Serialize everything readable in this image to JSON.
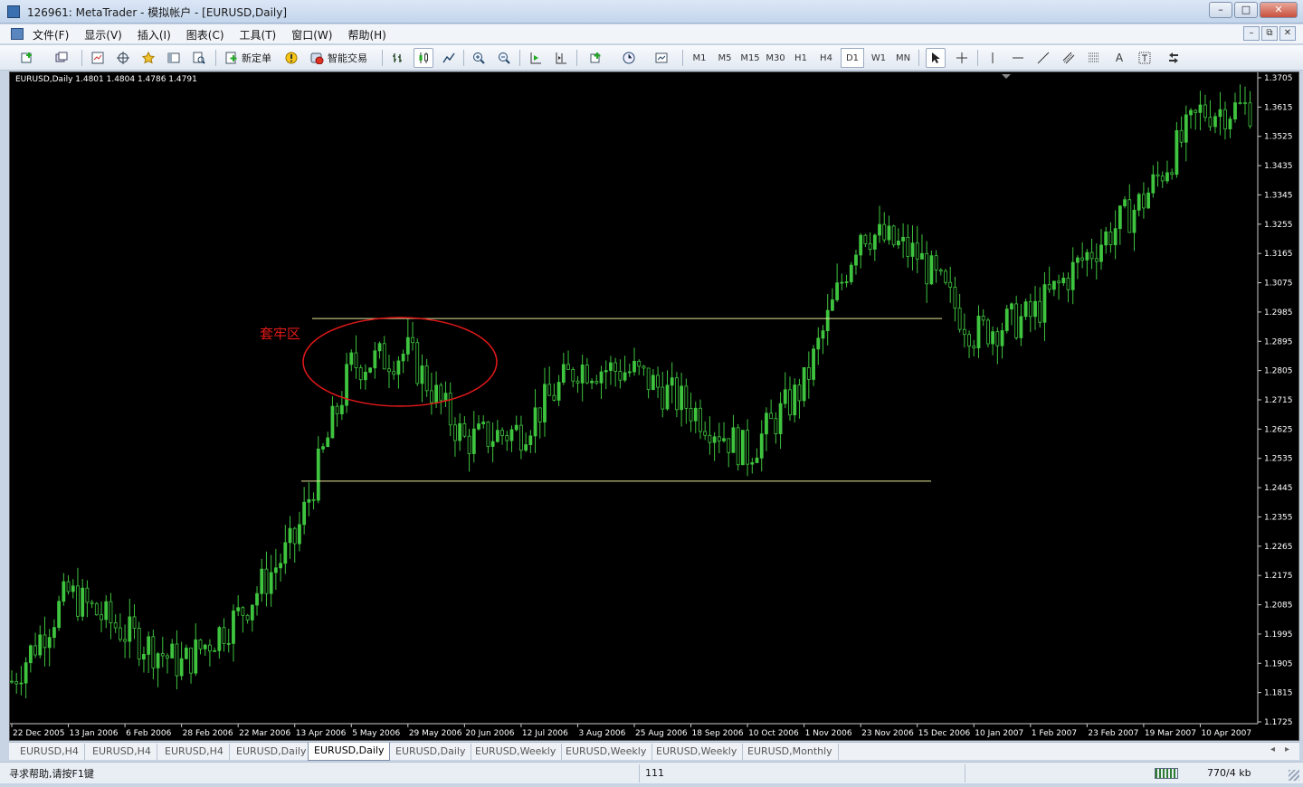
{
  "window": {
    "title": "126961: MetaTrader - 模拟帐户 - [EURUSD,Daily]",
    "buttons": [
      "–",
      "□",
      "✕"
    ]
  },
  "menu": {
    "items": [
      "文件(F)",
      "显示(V)",
      "插入(I)",
      "图表(C)",
      "工具(T)",
      "窗口(W)",
      "帮助(H)"
    ],
    "mdi_buttons": [
      "–",
      "⧉",
      "✕"
    ]
  },
  "toolbar": {
    "new_order_label": "新定单",
    "expert_label": "智能交易",
    "timeframes": [
      "M1",
      "M5",
      "M15",
      "M30",
      "H1",
      "H4",
      "D1",
      "W1",
      "MN"
    ],
    "active_timeframe": "D1",
    "text_tool_label": "A"
  },
  "chart": {
    "info": "EURUSD,Daily  1.4801 1.4804 1.4786 1.4791",
    "annotation_label": "套牢区",
    "colors": {
      "candle": "#3ec43e",
      "lines": "#e8e89a",
      "annotation": "#e01818",
      "text": "#ffffff"
    }
  },
  "chart_data": {
    "type": "candlestick",
    "symbol": "EURUSD",
    "timeframe": "Daily",
    "ohlc_last": {
      "open": 1.4801,
      "high": 1.4804,
      "low": 1.4786,
      "close": 1.4791
    },
    "y_ticks": [
      "1.3705",
      "1.3615",
      "1.3525",
      "1.3435",
      "1.3345",
      "1.3255",
      "1.3165",
      "1.3075",
      "1.2985",
      "1.2895",
      "1.2805",
      "1.2715",
      "1.2625",
      "1.2535",
      "1.2445",
      "1.2355",
      "1.2265",
      "1.2175",
      "1.2085",
      "1.1995",
      "1.1905",
      "1.1815",
      "1.1725"
    ],
    "ylim": [
      1.1725,
      1.3705
    ],
    "x_ticks": [
      "22 Dec 2005",
      "13 Jan 2006",
      "6 Feb 2006",
      "28 Feb 2006",
      "22 Mar 2006",
      "13 Apr 2006",
      "5 May 2006",
      "29 May 2006",
      "20 Jun 2006",
      "12 Jul 2006",
      "3 Aug 2006",
      "25 Aug 2006",
      "18 Sep 2006",
      "10 Oct 2006",
      "1 Nov 2006",
      "23 Nov 2006",
      "15 Dec 2006",
      "10 Jan 2007",
      "1 Feb 2007",
      "23 Feb 2007",
      "19 Mar 2007",
      "10 Apr 2007"
    ],
    "close_path": [
      {
        "x": "22 Dec 2005",
        "y": 1.185
      },
      {
        "x": "13 Jan 2006",
        "y": 1.212
      },
      {
        "x": "6 Feb 2006",
        "y": 1.2
      },
      {
        "x": "28 Feb 2006",
        "y": 1.19
      },
      {
        "x": "22 Mar 2006",
        "y": 1.205
      },
      {
        "x": "13 Apr 2006",
        "y": 1.228
      },
      {
        "x": "5 May 2006",
        "y": 1.282
      },
      {
        "x": "29 May 2006",
        "y": 1.286
      },
      {
        "x": "20 Jun 2006",
        "y": 1.259
      },
      {
        "x": "12 Jul 2006",
        "y": 1.262
      },
      {
        "x": "3 Aug 2006",
        "y": 1.282
      },
      {
        "x": "25 Aug 2006",
        "y": 1.28
      },
      {
        "x": "18 Sep 2006",
        "y": 1.269
      },
      {
        "x": "10 Oct 2006",
        "y": 1.255
      },
      {
        "x": "1 Nov 2006",
        "y": 1.276
      },
      {
        "x": "23 Nov 2006",
        "y": 1.324
      },
      {
        "x": "15 Dec 2006",
        "y": 1.316
      },
      {
        "x": "10 Jan 2007",
        "y": 1.292
      },
      {
        "x": "1 Feb 2007",
        "y": 1.297
      },
      {
        "x": "23 Feb 2007",
        "y": 1.316
      },
      {
        "x": "19 Mar 2007",
        "y": 1.333
      },
      {
        "x": "10 Apr 2007",
        "y": 1.36
      }
    ],
    "horizontal_lines": [
      {
        "level": 1.2965
      },
      {
        "level": 1.2465
      }
    ]
  },
  "tabs": {
    "items": [
      "EURUSD,H4",
      "EURUSD,H4",
      "EURUSD,H4",
      "EURUSD,Daily",
      "EURUSD,Daily",
      "EURUSD,Daily",
      "EURUSD,Weekly",
      "EURUSD,Weekly",
      "EURUSD,Weekly",
      "EURUSD,Monthly"
    ],
    "active_index": 4,
    "scroll_left": "◂",
    "scroll_right": "▸"
  },
  "status": {
    "help_text": "寻求帮助,请按F1键",
    "bars_count": "111",
    "traffic": "770/4 kb"
  }
}
